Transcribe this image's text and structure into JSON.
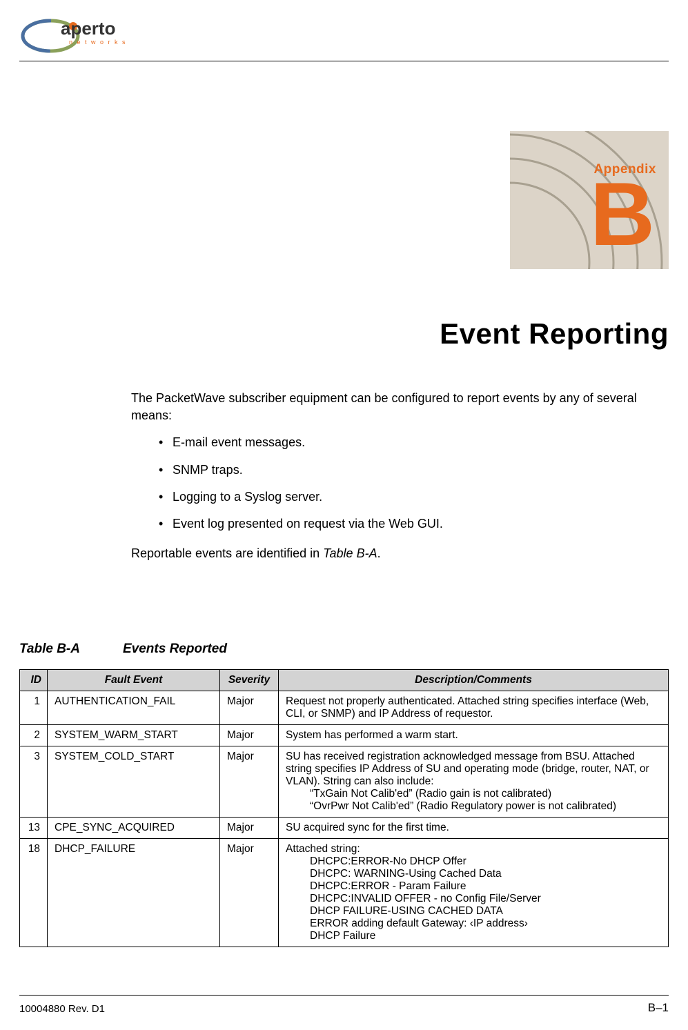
{
  "logo": {
    "brand": "aperto",
    "tagline": "n e t w o r k s"
  },
  "appendix": {
    "label": "Appendix",
    "letter": "B"
  },
  "title": "Event Reporting",
  "intro": "The PacketWave subscriber equipment can be configured to report events by any of several means:",
  "bullets": [
    "E-mail event messages.",
    "SNMP traps.",
    "Logging to a Syslog server.",
    "Event log presented on request via the Web GUI."
  ],
  "intro2_prefix": "Reportable events are identified in ",
  "intro2_ref": "Table B-A",
  "intro2_suffix": ".",
  "table": {
    "caption_num": "Table B-A",
    "caption_title": "Events Reported",
    "headers": [
      "ID",
      "Fault Event",
      "Severity",
      "Description/Comments"
    ],
    "rows": [
      {
        "id": "1",
        "fault": "AUTHENTICATION_FAIL",
        "severity": "Major",
        "desc": "Request not properly authenticated. Attached string specifies interface (Web, CLI, or SNMP) and IP Address of requestor.",
        "indent": ""
      },
      {
        "id": "2",
        "fault": "SYSTEM_WARM_START",
        "severity": "Major",
        "desc": "System has performed a warm start.",
        "indent": ""
      },
      {
        "id": "3",
        "fault": "SYSTEM_COLD_START",
        "severity": "Major",
        "desc": "SU has received registration acknowledged message from BSU. Attached string specifies IP Address of SU and operating mode (bridge, router, NAT, or VLAN). String can also include:",
        "indent": "“TxGain Not Calib'ed” (Radio gain is not calibrated)\n“OvrPwr Not Calib'ed” (Radio Regulatory power is not calibrated)"
      },
      {
        "id": "13",
        "fault": "CPE_SYNC_ACQUIRED",
        "severity": "Major",
        "desc": "SU acquired sync for the first time.",
        "indent": ""
      },
      {
        "id": "18",
        "fault": "DHCP_FAILURE",
        "severity": "Major",
        "desc": "Attached string:",
        "indent": "DHCPC:ERROR-No DHCP Offer\nDHCPC: WARNING-Using Cached Data\nDHCPC:ERROR - Param Failure\nDHCPC:INVALID OFFER - no Config File/Server\nDHCP FAILURE-USING CACHED DATA\nERROR adding default Gateway: ‹IP address›\nDHCP Failure"
      }
    ]
  },
  "footer": {
    "left": "10004880 Rev. D1",
    "right": "B–1"
  }
}
